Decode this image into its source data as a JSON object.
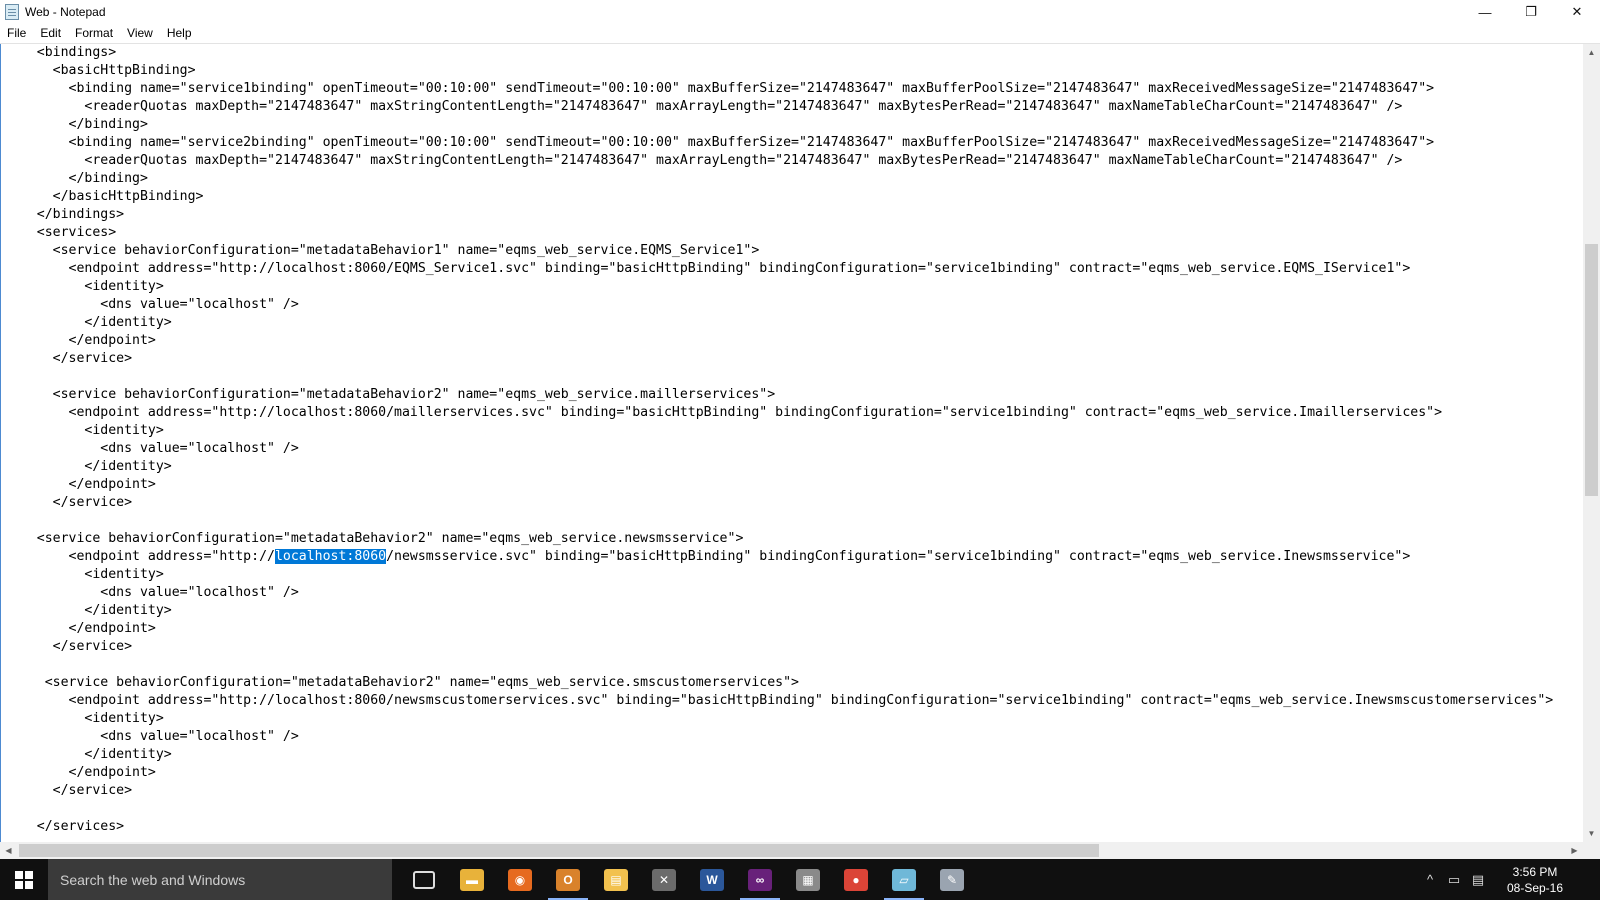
{
  "window": {
    "title": "Web - Notepad",
    "minimize": "—",
    "restore": "❐",
    "close": "✕"
  },
  "menu": [
    "File",
    "Edit",
    "Format",
    "View",
    "Help"
  ],
  "editor": {
    "lines_before": [
      "    <bindings>",
      "      <basicHttpBinding>",
      "        <binding name=\"service1binding\" openTimeout=\"00:10:00\" sendTimeout=\"00:10:00\" maxBufferSize=\"2147483647\" maxBufferPoolSize=\"2147483647\" maxReceivedMessageSize=\"2147483647\">",
      "          <readerQuotas maxDepth=\"2147483647\" maxStringContentLength=\"2147483647\" maxArrayLength=\"2147483647\" maxBytesPerRead=\"2147483647\" maxNameTableCharCount=\"2147483647\" />",
      "        </binding>",
      "        <binding name=\"service2binding\" openTimeout=\"00:10:00\" sendTimeout=\"00:10:00\" maxBufferSize=\"2147483647\" maxBufferPoolSize=\"2147483647\" maxReceivedMessageSize=\"2147483647\">",
      "          <readerQuotas maxDepth=\"2147483647\" maxStringContentLength=\"2147483647\" maxArrayLength=\"2147483647\" maxBytesPerRead=\"2147483647\" maxNameTableCharCount=\"2147483647\" />",
      "        </binding>",
      "      </basicHttpBinding>",
      "    </bindings>",
      "    <services>",
      "      <service behaviorConfiguration=\"metadataBehavior1\" name=\"eqms_web_service.EQMS_Service1\">",
      "        <endpoint address=\"http://localhost:8060/EQMS_Service1.svc\" binding=\"basicHttpBinding\" bindingConfiguration=\"service1binding\" contract=\"eqms_web_service.EQMS_IService1\">",
      "          <identity>",
      "            <dns value=\"localhost\" />",
      "          </identity>",
      "        </endpoint>",
      "      </service>",
      "",
      "      <service behaviorConfiguration=\"metadataBehavior2\" name=\"eqms_web_service.maillerservices\">",
      "        <endpoint address=\"http://localhost:8060/maillerservices.svc\" binding=\"basicHttpBinding\" bindingConfiguration=\"service1binding\" contract=\"eqms_web_service.Imaillerservices\">",
      "          <identity>",
      "            <dns value=\"localhost\" />",
      "          </identity>",
      "        </endpoint>",
      "      </service>",
      "",
      "    <service behaviorConfiguration=\"metadataBehavior2\" name=\"eqms_web_service.newsmsservice\">"
    ],
    "selected_line": {
      "before": "        <endpoint address=\"http://",
      "selected": "localhost:8060",
      "after": "/newsmsservice.svc\" binding=\"basicHttpBinding\" bindingConfiguration=\"service1binding\" contract=\"eqms_web_service.Inewsmsservice\">"
    },
    "lines_after": [
      "          <identity>",
      "            <dns value=\"localhost\" />",
      "          </identity>",
      "        </endpoint>",
      "      </service>",
      "",
      "     <service behaviorConfiguration=\"metadataBehavior2\" name=\"eqms_web_service.smscustomerservices\">",
      "        <endpoint address=\"http://localhost:8060/newsmscustomerservices.svc\" binding=\"basicHttpBinding\" bindingConfiguration=\"service1binding\" contract=\"eqms_web_service.Inewsmscustomerservices\">",
      "          <identity>",
      "            <dns value=\"localhost\" />",
      "          </identity>",
      "        </endpoint>",
      "      </service>",
      "",
      "    </services>"
    ]
  },
  "taskbar": {
    "search_placeholder": "Search the web and Windows",
    "apps": [
      {
        "name": "task-view",
        "glyph": "▭",
        "color": "#101010"
      },
      {
        "name": "file-explorer-folder",
        "glyph": "▬",
        "color": "#e8b23a"
      },
      {
        "name": "firefox",
        "glyph": "◉",
        "color": "#e66a1f"
      },
      {
        "name": "outlook",
        "glyph": "O",
        "color": "#d9822b"
      },
      {
        "name": "file-explorer",
        "glyph": "▤",
        "color": "#f2c14e"
      },
      {
        "name": "tools",
        "glyph": "✕",
        "color": "#6b6b6b"
      },
      {
        "name": "word",
        "glyph": "W",
        "color": "#2b579a"
      },
      {
        "name": "visual-studio",
        "glyph": "∞",
        "color": "#68217a"
      },
      {
        "name": "sql-server",
        "glyph": "▦",
        "color": "#8a8a8a"
      },
      {
        "name": "chrome",
        "glyph": "●",
        "color": "#db4437"
      },
      {
        "name": "notepad",
        "glyph": "▱",
        "color": "#6fb8d8"
      },
      {
        "name": "paint",
        "glyph": "✎",
        "color": "#9aa4b0"
      }
    ],
    "tray_up": "^",
    "tray_network": "▭",
    "tray_notes": "▤",
    "time": "3:56 PM",
    "date": "08-Sep-16"
  }
}
